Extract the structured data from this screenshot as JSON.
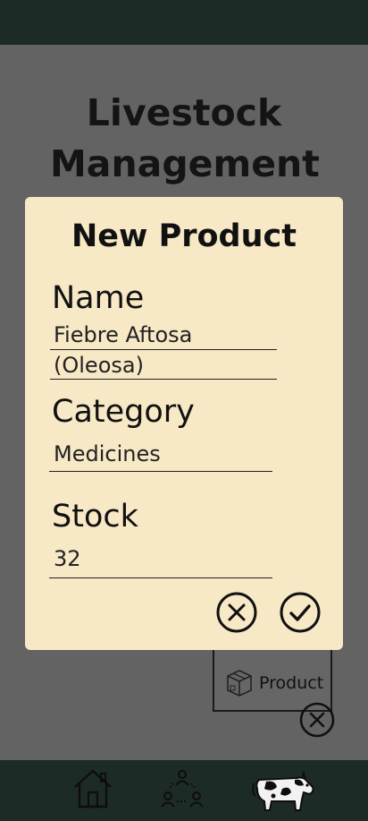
{
  "app": {
    "title": "Livestock Management"
  },
  "background_card": {
    "label": "Product"
  },
  "modal": {
    "title": "New Product",
    "fields": {
      "name": {
        "label": "Name",
        "value_line1": "Fiebre Aftosa",
        "value_line2": "(Oleosa)"
      },
      "category": {
        "label": "Category",
        "value": "Medicines"
      },
      "stock": {
        "label": "Stock",
        "value": "32"
      }
    },
    "buttons": {
      "cancel_icon": "circle-x-icon",
      "confirm_icon": "circle-check-icon"
    }
  },
  "nav": {
    "items": [
      {
        "icon": "home-icon"
      },
      {
        "icon": "people-network-icon"
      },
      {
        "icon": "cow-icon"
      }
    ]
  },
  "colors": {
    "bar": "#1d2b27",
    "overlay": "#636363",
    "modal": "#f7e8c6"
  }
}
